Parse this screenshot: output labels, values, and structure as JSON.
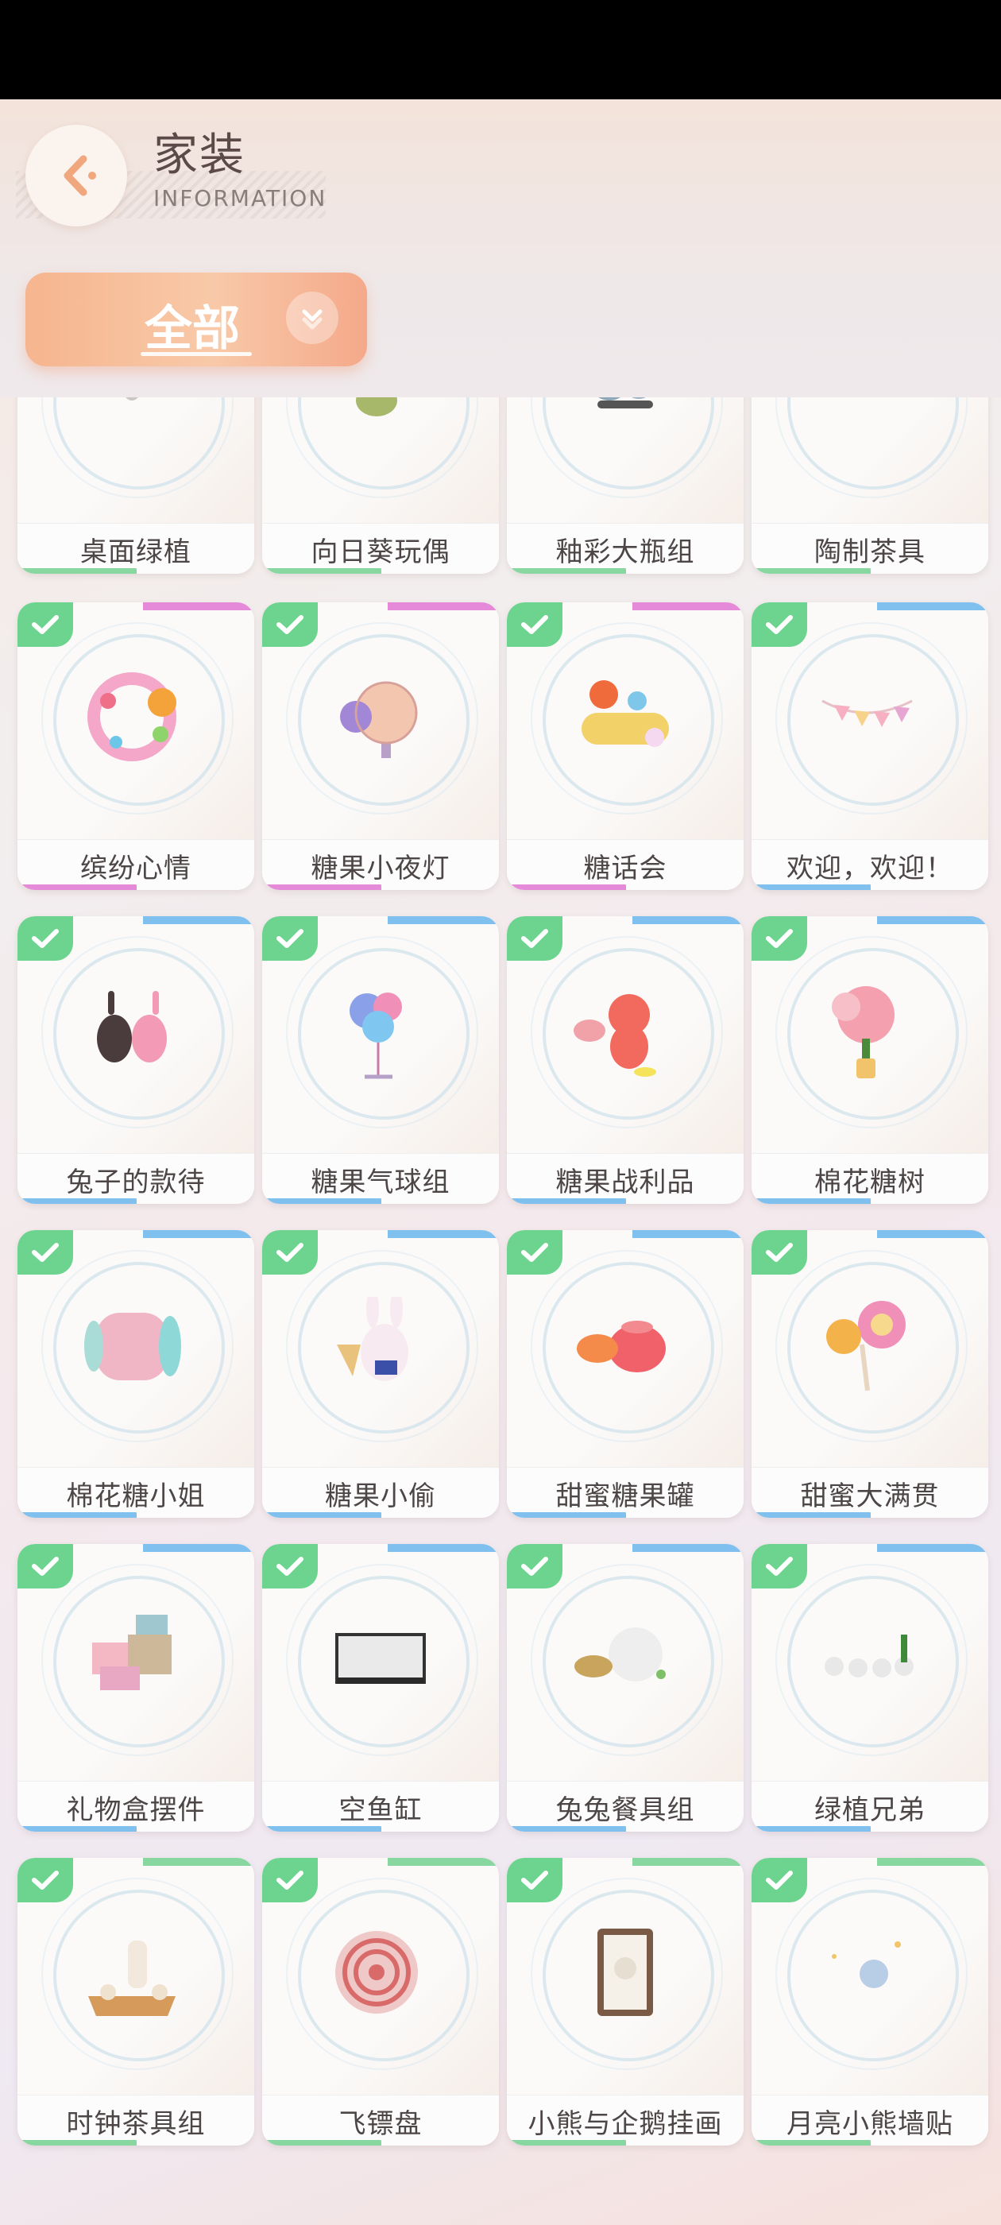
{
  "header": {
    "title": "家装",
    "subtitle": "INFORMATION"
  },
  "filter": {
    "label": "全部"
  },
  "colors": {
    "accent_orange": "#f6b58e",
    "check_green": "#6dd48f",
    "text_dark": "#4d4646"
  },
  "items": [
    {
      "name": "桌面绿植",
      "owned": false,
      "icon": "plant-pot-icon",
      "stripe": "#88d6a0"
    },
    {
      "name": "向日葵玩偶",
      "owned": false,
      "icon": "sunflower-doll-icon",
      "stripe": "#88d6a0"
    },
    {
      "name": "釉彩大瓶组",
      "owned": false,
      "icon": "vase-set-icon",
      "stripe": "#88d6a0"
    },
    {
      "name": "陶制茶具",
      "owned": false,
      "icon": "tea-set-icon",
      "stripe": "#88d6a0"
    },
    {
      "name": "缤纷心情",
      "owned": true,
      "icon": "candy-wreath-icon",
      "stripe": "#e58ad8"
    },
    {
      "name": "糖果小夜灯",
      "owned": true,
      "icon": "candy-lamp-icon",
      "stripe": "#e58ad8"
    },
    {
      "name": "糖话会",
      "owned": true,
      "icon": "candy-party-icon",
      "stripe": "#e58ad8"
    },
    {
      "name": "欢迎，欢迎！",
      "owned": true,
      "icon": "bunting-icon",
      "stripe": "#7fc0ef"
    },
    {
      "name": "兔子的款待",
      "owned": true,
      "icon": "bunny-host-icon",
      "stripe": "#7fc0ef"
    },
    {
      "name": "糖果气球组",
      "owned": true,
      "icon": "balloon-icon",
      "stripe": "#7fc0ef"
    },
    {
      "name": "糖果战利品",
      "owned": true,
      "icon": "gummy-bear-icon",
      "stripe": "#7fc0ef"
    },
    {
      "name": "棉花糖树",
      "owned": true,
      "icon": "cotton-candy-tree-icon",
      "stripe": "#7fc0ef"
    },
    {
      "name": "棉花糖小姐",
      "owned": true,
      "icon": "marshmallow-pillow-icon",
      "stripe": "#7fc0ef"
    },
    {
      "name": "糖果小偷",
      "owned": true,
      "icon": "bunny-thief-icon",
      "stripe": "#7fc0ef"
    },
    {
      "name": "甜蜜糖果罐",
      "owned": true,
      "icon": "candy-jar-icon",
      "stripe": "#7fc0ef"
    },
    {
      "name": "甜蜜大满贯",
      "owned": true,
      "icon": "lollipop-icon",
      "stripe": "#7fc0ef"
    },
    {
      "name": "礼物盒摆件",
      "owned": true,
      "icon": "gift-box-icon",
      "stripe": "#7fc0ef"
    },
    {
      "name": "空鱼缸",
      "owned": true,
      "icon": "fish-tank-icon",
      "stripe": "#7fc0ef"
    },
    {
      "name": "兔兔餐具组",
      "owned": true,
      "icon": "bunny-tableware-icon",
      "stripe": "#7fc0ef"
    },
    {
      "name": "绿植兄弟",
      "owned": true,
      "icon": "plant-brothers-icon",
      "stripe": "#7fc0ef"
    },
    {
      "name": "时钟茶具组",
      "owned": true,
      "icon": "clock-tea-set-icon",
      "stripe": "#88d6a0"
    },
    {
      "name": "飞镖盘",
      "owned": true,
      "icon": "dartboard-icon",
      "stripe": "#88d6a0"
    },
    {
      "name": "小熊与企鹅挂画",
      "owned": true,
      "icon": "bear-penguin-painting-icon",
      "stripe": "#88d6a0"
    },
    {
      "name": "月亮小熊墙贴",
      "owned": true,
      "icon": "moon-bear-sticker-icon",
      "stripe": "#88d6a0"
    }
  ]
}
